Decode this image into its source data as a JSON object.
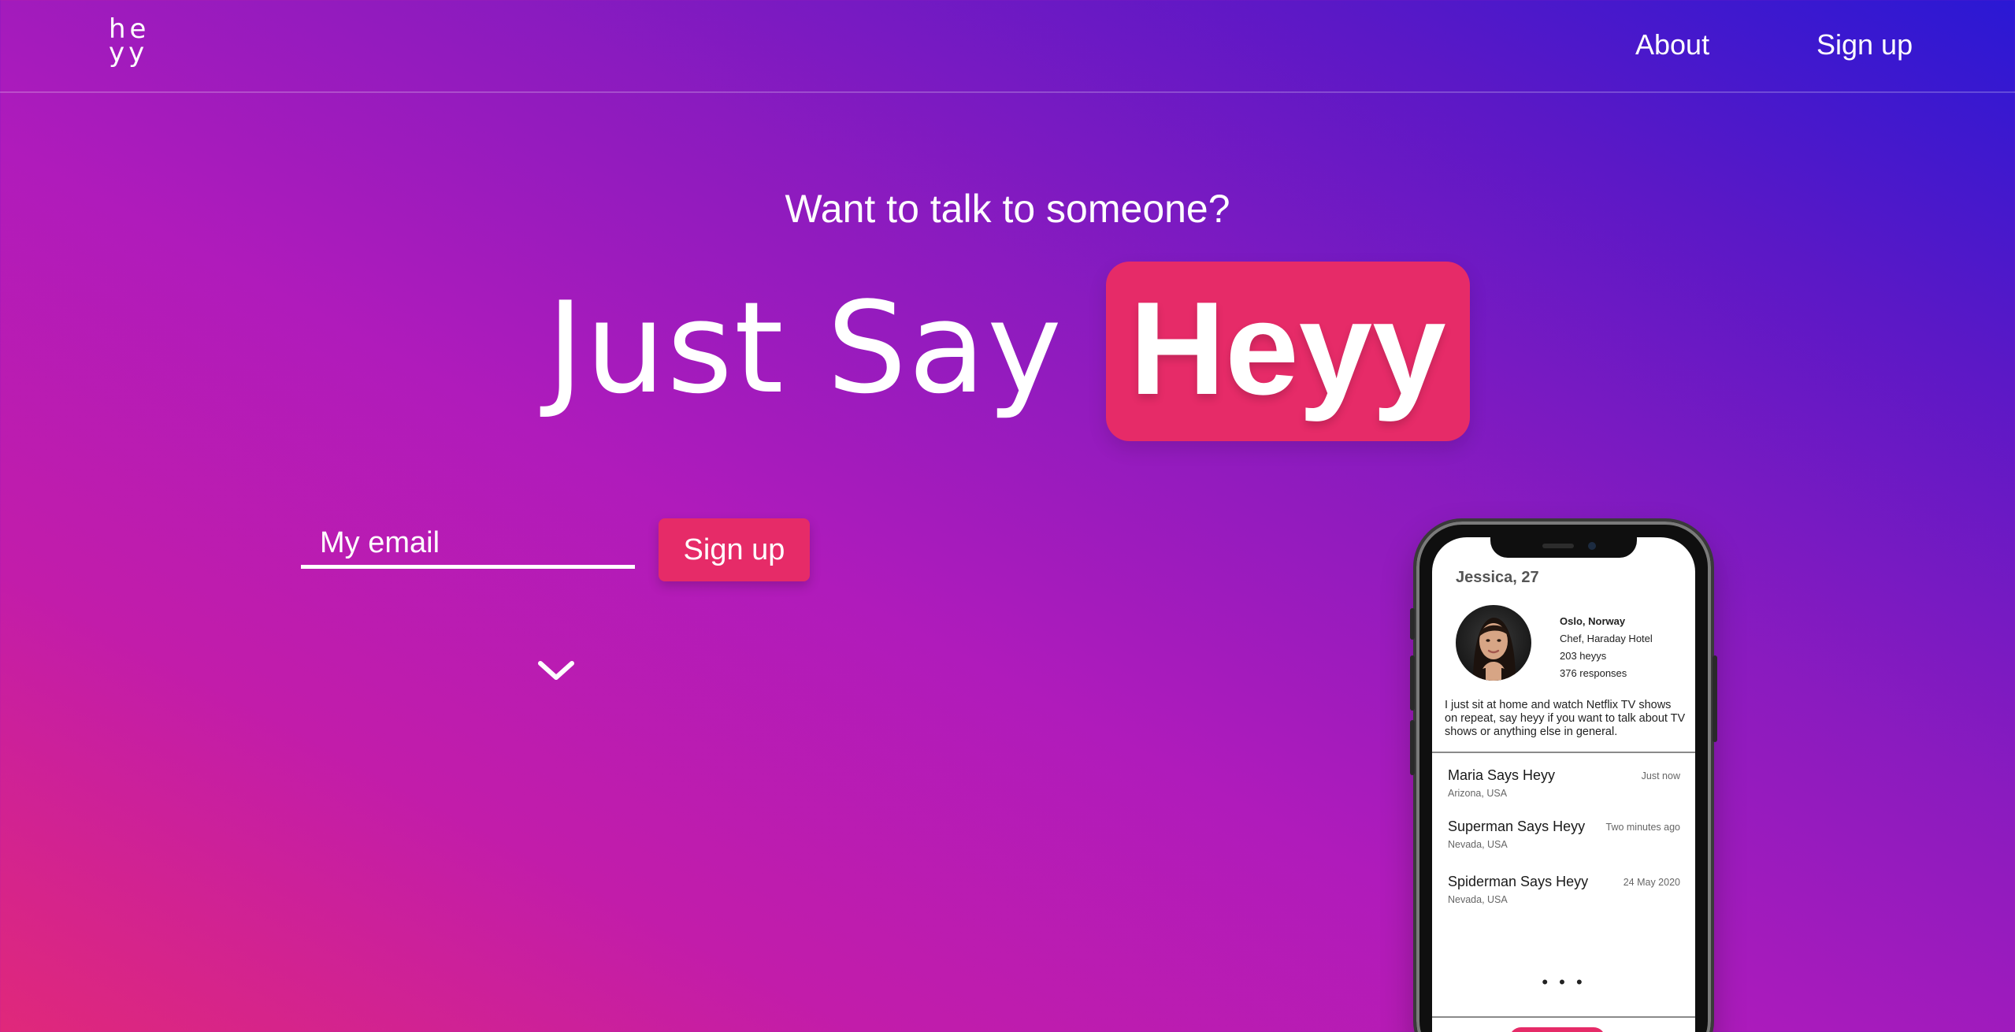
{
  "header": {
    "logo_top": "he",
    "logo_bottom": "yy",
    "nav": {
      "about": "About",
      "signup": "Sign up"
    }
  },
  "hero": {
    "tagline": "Want to talk to someone?",
    "headline": "Just Say",
    "headline_highlight": "Heyy"
  },
  "signup_form": {
    "email_placeholder": "My email",
    "button_label": "Sign up"
  },
  "phone": {
    "profile": {
      "name_age": "Jessica, 27",
      "location": "Oslo, Norway",
      "job": "Chef, Haraday Hotel",
      "heyys": "203 heyys",
      "responses": "376 responses",
      "bio": "I just sit at home and watch Netflix TV shows on repeat, say heyy if you want to talk about TV shows or anything else in general."
    },
    "messages": [
      {
        "title": "Maria Says Heyy",
        "time": "Just now",
        "location": "Arizona, USA"
      },
      {
        "title": "Superman Says Heyy",
        "time": "Two minutes ago",
        "location": "Nevada, USA"
      },
      {
        "title": "Spiderman Says Heyy",
        "time": "24 May 2020",
        "location": "Nevada, USA"
      }
    ],
    "more": "• • •"
  },
  "colors": {
    "accent": "#e62b68",
    "gradient_start": "#e0287a",
    "gradient_mid": "#b01bbb",
    "gradient_end": "#2a18d4"
  },
  "icons": {
    "scroll": "chevron-down-icon"
  }
}
